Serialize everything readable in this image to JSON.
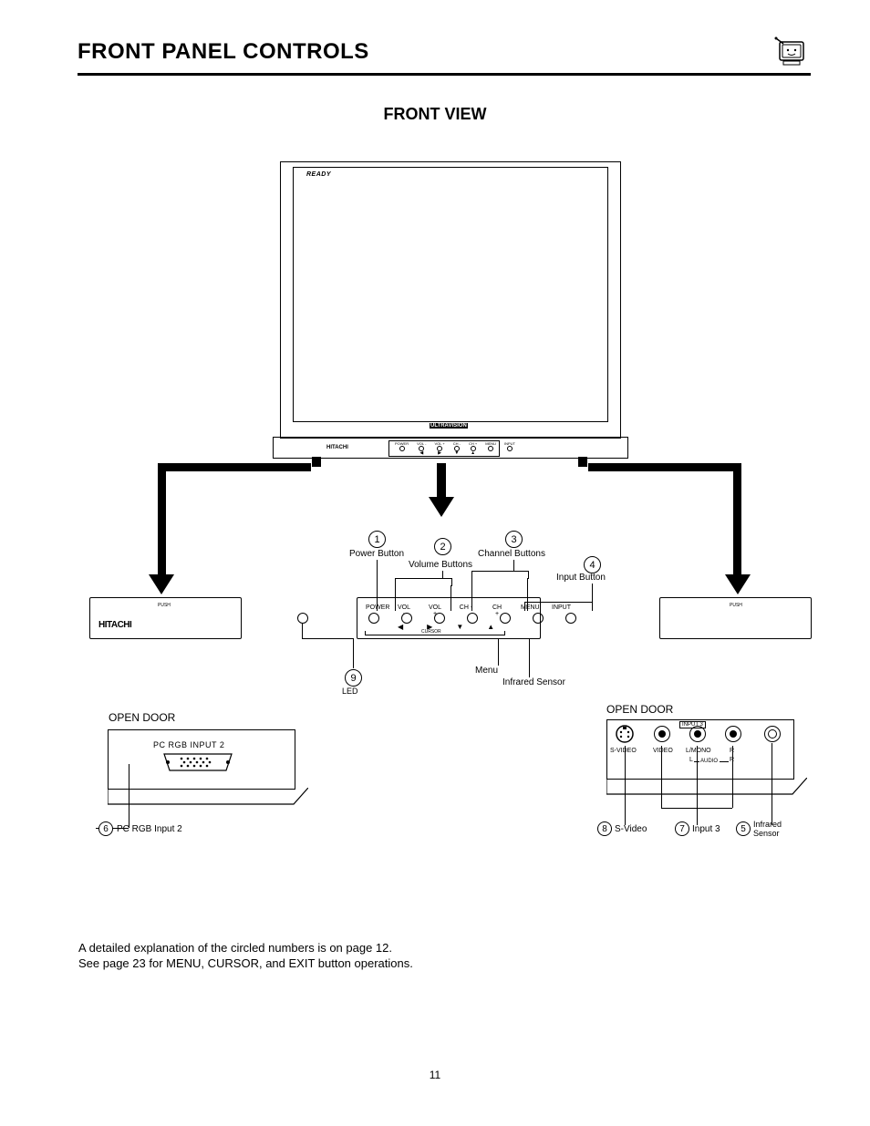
{
  "header": {
    "title": "FRONT PANEL CONTROLS"
  },
  "subtitle": "FRONT VIEW",
  "tv": {
    "ready": "READY",
    "brand": "HITACHI",
    "series": "ULTRAVISION",
    "panel_labels": [
      "POWER",
      "VOL -",
      "VOL +",
      "CH -",
      "CH +",
      "MENU",
      "INPUT"
    ],
    "cursor_label": "CURSOR",
    "push": "PUSH"
  },
  "callouts": {
    "c1": {
      "num": "1",
      "label": "Power Button"
    },
    "c2": {
      "num": "2",
      "label": "Volume Buttons"
    },
    "c3": {
      "num": "3",
      "label": "Channel Buttons"
    },
    "c4": {
      "num": "4",
      "label": "Input Button"
    },
    "c5": {
      "num": "5",
      "label_a": "Infrared",
      "label_b": "Sensor"
    },
    "c6": {
      "num": "6",
      "label": "PC RGB Input 2"
    },
    "c7": {
      "num": "7",
      "label": "Input 3"
    },
    "c8": {
      "num": "8",
      "label": "S-Video"
    },
    "c9": {
      "num": "9",
      "label": "LED"
    },
    "menu": "Menu",
    "ir_sensor": "Infrared Sensor"
  },
  "left_door": {
    "title": "OPEN DOOR",
    "port_label": "PC RGB INPUT 2"
  },
  "right_door": {
    "title": "OPEN DOOR",
    "input3_box": "INPUT 3",
    "svideo": "S-VIDEO",
    "video": "VIDEO",
    "lmono": "L/MONO",
    "r": "R",
    "l_br": "L",
    "audio": "AUDIO",
    "r_br": "R"
  },
  "notes": {
    "line1": "A detailed explanation of the circled numbers is on page 12.",
    "line2": "See page 23 for MENU, CURSOR, and EXIT button operations."
  },
  "page_number": "11"
}
